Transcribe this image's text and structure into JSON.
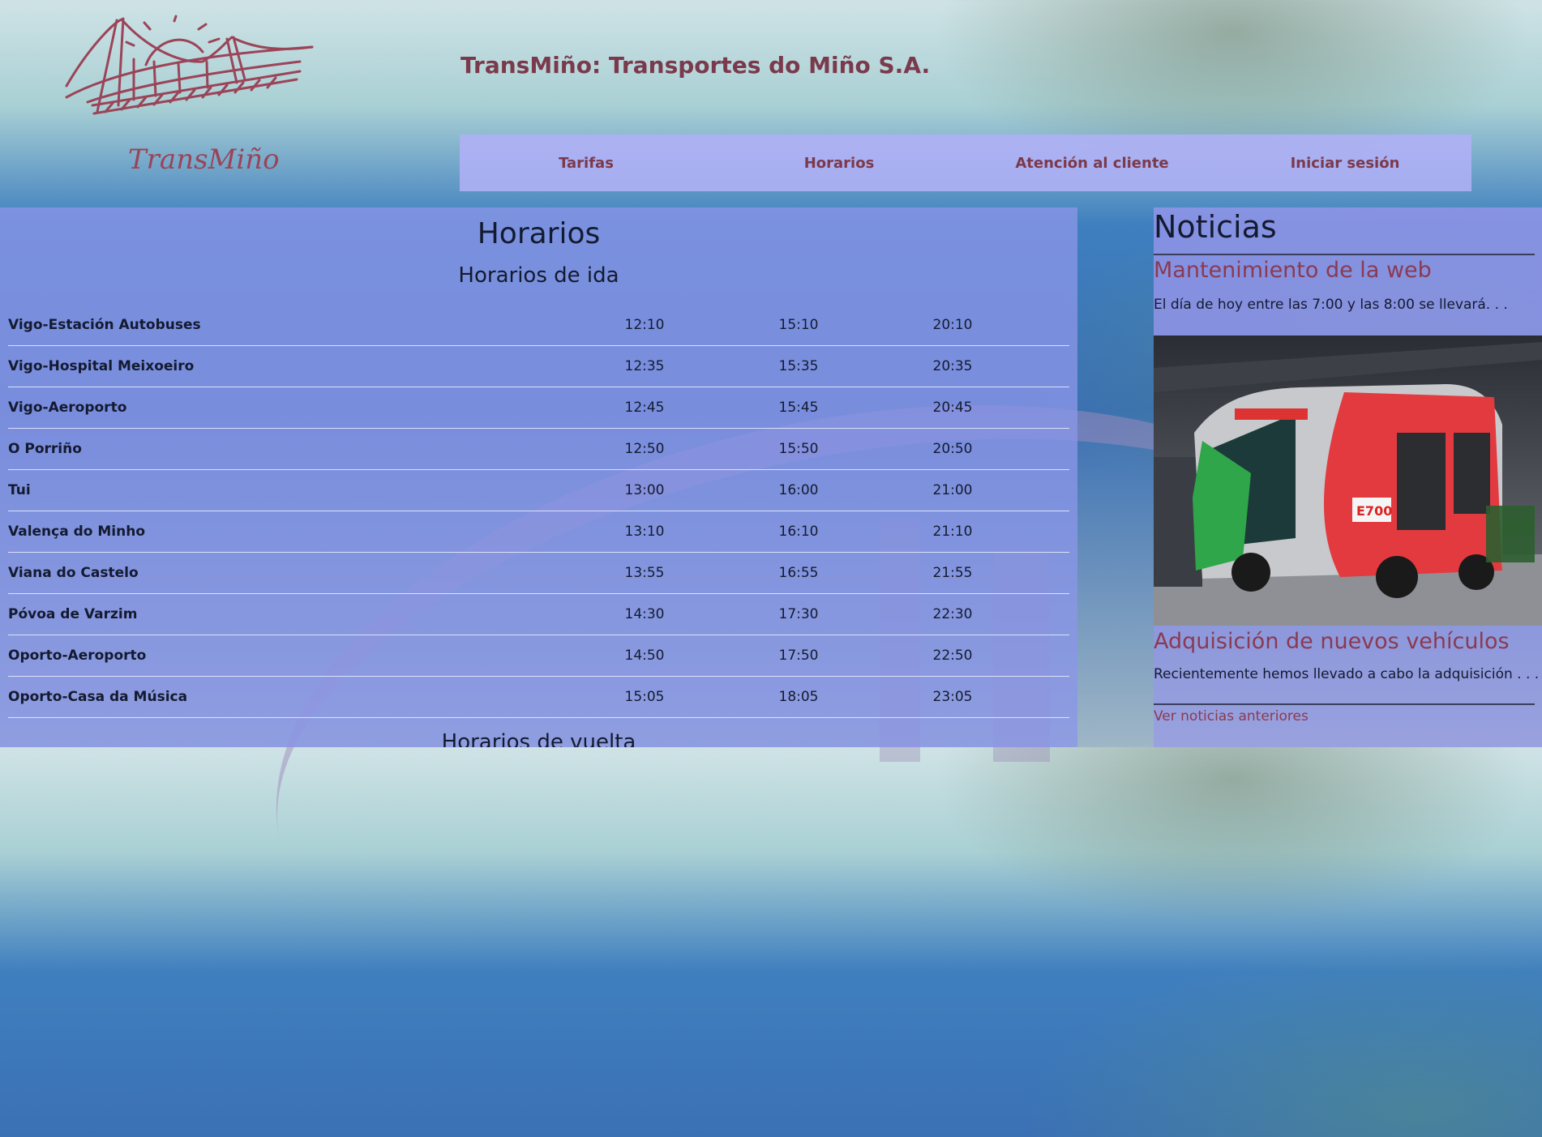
{
  "brand": {
    "logo_text": "TransMiño",
    "site_title": "TransMiño: Transportes do Miño S.A."
  },
  "nav": {
    "items": [
      {
        "label": "Tarifas"
      },
      {
        "label": "Horarios"
      },
      {
        "label": "Atención al cliente"
      },
      {
        "label": "Iniciar sesión"
      }
    ]
  },
  "schedule": {
    "title": "Horarios",
    "outbound_title": "Horarios de ida",
    "return_title": "Horarios de vuelta",
    "rows": [
      {
        "stop": "Vigo-Estación Autobuses",
        "t1": "12:10",
        "t2": "15:10",
        "t3": "20:10"
      },
      {
        "stop": "Vigo-Hospital Meixoeiro",
        "t1": "12:35",
        "t2": "15:35",
        "t3": "20:35"
      },
      {
        "stop": "Vigo-Aeroporto",
        "t1": "12:45",
        "t2": "15:45",
        "t3": "20:45"
      },
      {
        "stop": "O Porriño",
        "t1": "12:50",
        "t2": "15:50",
        "t3": "20:50"
      },
      {
        "stop": "Tui",
        "t1": "13:00",
        "t2": "16:00",
        "t3": "21:00"
      },
      {
        "stop": "Valença do Minho",
        "t1": "13:10",
        "t2": "16:10",
        "t3": "21:10"
      },
      {
        "stop": "Viana do Castelo",
        "t1": "13:55",
        "t2": "16:55",
        "t3": "21:55"
      },
      {
        "stop": "Póvoa de Varzim",
        "t1": "14:30",
        "t2": "17:30",
        "t3": "22:30"
      },
      {
        "stop": "Oporto-Aeroporto",
        "t1": "14:50",
        "t2": "17:50",
        "t3": "22:50"
      },
      {
        "stop": "Oporto-Casa da Música",
        "t1": "15:05",
        "t2": "18:05",
        "t3": "23:05"
      }
    ]
  },
  "news": {
    "title": "Noticias",
    "items": [
      {
        "title": "Mantenimiento de la web",
        "text": "El día de hoy entre las 7:00 y las 8:00 se llevará. . ."
      },
      {
        "title": "Adquisición de nuevos vehículos",
        "text": "Recientemente hemos llevado a cabo la adquisición . . ."
      }
    ],
    "bus_label": "E700",
    "more_link": "Ver noticias anteriores"
  },
  "colors": {
    "brand": "#7b3a4c",
    "nav_bg": "#b0b0f6",
    "panel_bg": "#8a96e8",
    "text_dark": "#141a30"
  }
}
